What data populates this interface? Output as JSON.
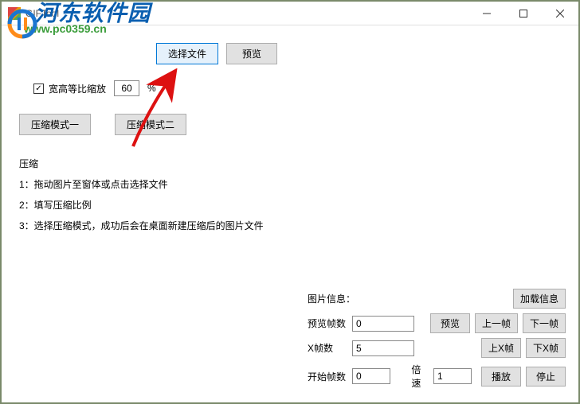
{
  "window": {
    "title": "GIFTool"
  },
  "watermark": {
    "brand": "河东软件园",
    "url": "www.pc0359.cn"
  },
  "toolbar_top": {
    "select_file": "选择文件",
    "preview": "预览"
  },
  "scale_row": {
    "checkbox_label": "宽高等比缩放",
    "value": "60",
    "percent": "%"
  },
  "mode_row": {
    "mode1": "压缩模式一",
    "mode2": "压缩模式二"
  },
  "instructions": {
    "heading": "压缩",
    "line1": "1：拖动图片至窗体或点击选择文件",
    "line2": "2：填写压缩比例",
    "line3": "3：选择压缩模式，成功后会在桌面新建压缩后的图片文件"
  },
  "info_panel": {
    "title": "图片信息：",
    "load_info": "加载信息",
    "preview_frames_label": "预览帧数",
    "preview_frames_value": "0",
    "preview_btn": "预览",
    "prev_frame": "上一帧",
    "next_frame": "下一帧",
    "x_frames_label": "X帧数",
    "x_frames_value": "5",
    "up_x": "上X帧",
    "down_x": "下X帧",
    "start_frames_label": "开始帧数",
    "start_frames_value": "0",
    "speed_label": "倍速",
    "speed_value": "1",
    "play": "播放",
    "stop": "停止"
  }
}
